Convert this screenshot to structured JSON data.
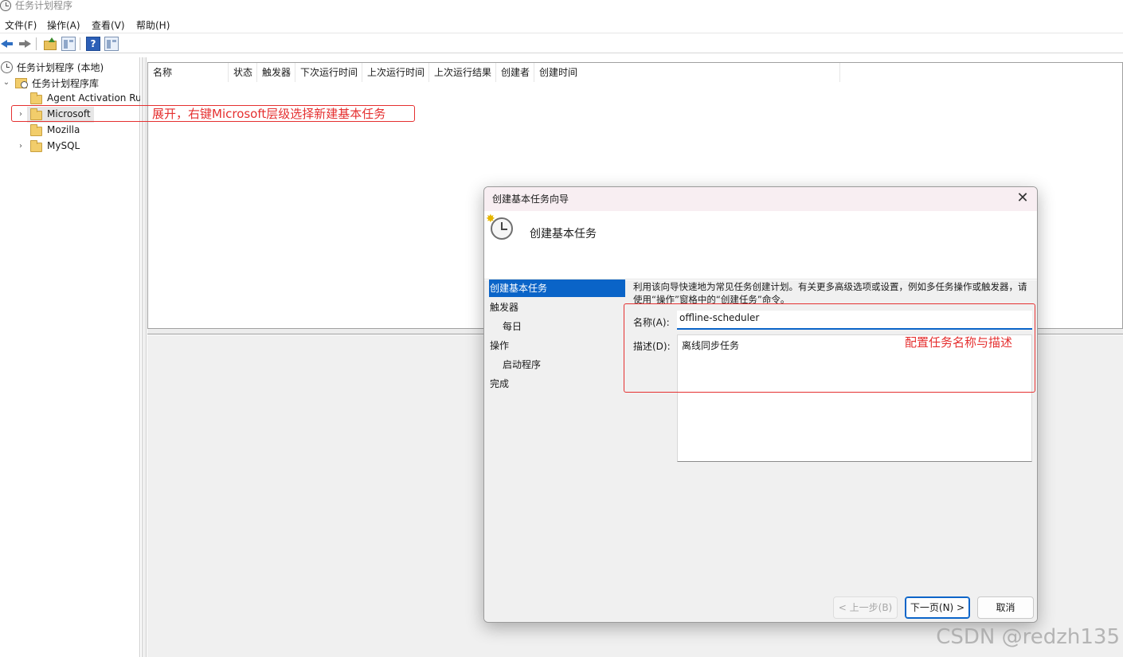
{
  "window": {
    "title": "任务计划程序"
  },
  "menu": [
    "文件(F)",
    "操作(A)",
    "查看(V)",
    "帮助(H)"
  ],
  "toolbar": {
    "help_glyph": "?"
  },
  "tree": {
    "root": "任务计划程序 (本地)",
    "library": "任务计划程序库",
    "items": [
      "Agent Activation Runtime",
      "Microsoft",
      "Mozilla",
      "MySQL"
    ]
  },
  "list": {
    "columns": [
      "名称",
      "状态",
      "触发器",
      "下次运行时间",
      "上次运行时间",
      "上次运行结果",
      "创建者",
      "创建时间"
    ]
  },
  "annotations": {
    "tree_note": "展开，右键Microsoft层级选择新建基本任务",
    "form_note": "配置任务名称与描述"
  },
  "dialog": {
    "title": "创建基本任务向导",
    "close_glyph": "✕",
    "heading": "创建基本任务",
    "steps": [
      "创建基本任务",
      "触发器",
      "每日",
      "操作",
      "启动程序",
      "完成"
    ],
    "intro": "利用该向导快速地为常见任务创建计划。有关更多高级选项或设置，例如多任务操作或触发器，请使用“操作”窗格中的“创建任务”命令。",
    "name_label": "名称(A):",
    "name_value": "offline-scheduler",
    "desc_label": "描述(D):",
    "desc_value": "离线同步任务",
    "buttons": {
      "back": "< 上一步(B)",
      "next": "下一页(N) >",
      "cancel": "取消"
    }
  },
  "watermark": "CSDN @redzh135",
  "colors": {
    "accent": "#0a64c8",
    "annotation": "#e53030",
    "dialog_title_bg": "#f8eef2"
  }
}
